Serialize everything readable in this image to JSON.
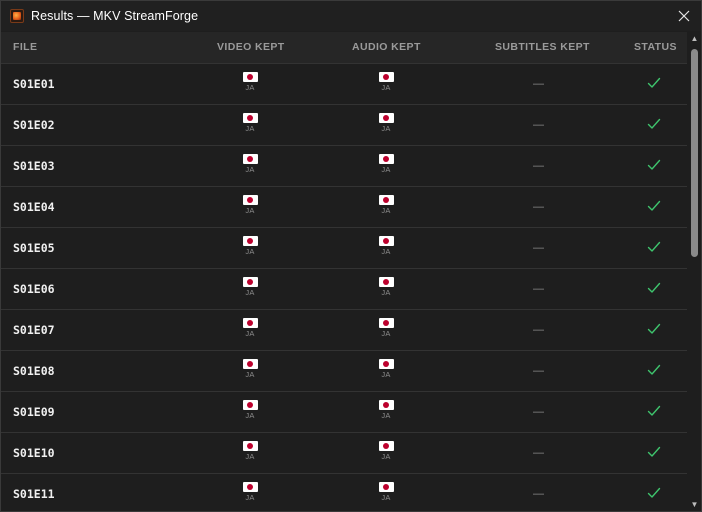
{
  "window": {
    "title": "Results — MKV StreamForge",
    "app_icon": "streamforge-app-icon",
    "close_icon": "close-icon"
  },
  "table": {
    "columns": {
      "file": "FILE",
      "video": "VIDEO KEPT",
      "audio": "AUDIO KEPT",
      "subtitles": "SUBTITLES KEPT",
      "status": "STATUS"
    },
    "rows": [
      {
        "file": "S01E01",
        "video_lang": "JA",
        "audio_lang": "JA",
        "subtitles": "—",
        "status": "ok"
      },
      {
        "file": "S01E02",
        "video_lang": "JA",
        "audio_lang": "JA",
        "subtitles": "—",
        "status": "ok"
      },
      {
        "file": "S01E03",
        "video_lang": "JA",
        "audio_lang": "JA",
        "subtitles": "—",
        "status": "ok"
      },
      {
        "file": "S01E04",
        "video_lang": "JA",
        "audio_lang": "JA",
        "subtitles": "—",
        "status": "ok"
      },
      {
        "file": "S01E05",
        "video_lang": "JA",
        "audio_lang": "JA",
        "subtitles": "—",
        "status": "ok"
      },
      {
        "file": "S01E06",
        "video_lang": "JA",
        "audio_lang": "JA",
        "subtitles": "—",
        "status": "ok"
      },
      {
        "file": "S01E07",
        "video_lang": "JA",
        "audio_lang": "JA",
        "subtitles": "—",
        "status": "ok"
      },
      {
        "file": "S01E08",
        "video_lang": "JA",
        "audio_lang": "JA",
        "subtitles": "—",
        "status": "ok"
      },
      {
        "file": "S01E09",
        "video_lang": "JA",
        "audio_lang": "JA",
        "subtitles": "—",
        "status": "ok"
      },
      {
        "file": "S01E10",
        "video_lang": "JA",
        "audio_lang": "JA",
        "subtitles": "—",
        "status": "ok"
      },
      {
        "file": "S01E11",
        "video_lang": "JA",
        "audio_lang": "JA",
        "subtitles": "—",
        "status": "ok"
      }
    ]
  },
  "colors": {
    "background": "#1e1e1e",
    "header_background": "#262626",
    "status_ok": "#3ec46d",
    "flag_red": "#bc002d"
  },
  "icons": {
    "flag": "japan-flag-icon",
    "status_ok": "checkmark-icon"
  }
}
